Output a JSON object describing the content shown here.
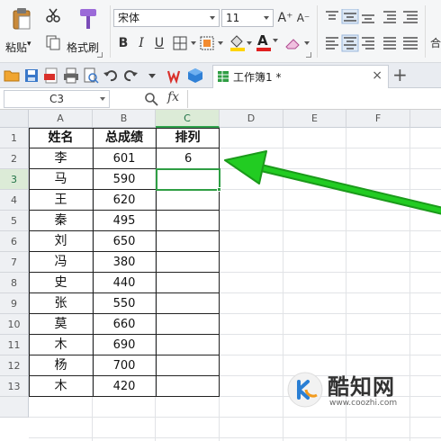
{
  "ribbon": {
    "paste_label": "粘贴",
    "format_painter_label": "格式刷",
    "font_name": "宋体",
    "font_size": "11",
    "grow_font": "A⁺",
    "shrink_font": "A⁻",
    "bold": "B",
    "italic": "I",
    "underline": "U",
    "font_color_letter": "A",
    "partial_right": "合"
  },
  "doc_tab": {
    "title": "工作簿1 *"
  },
  "formula_bar": {
    "name_box": "C3",
    "fx": "fx",
    "formula": ""
  },
  "columns": [
    "A",
    "B",
    "C",
    "D",
    "E",
    "F"
  ],
  "rows": [
    "1",
    "2",
    "3",
    "4",
    "5",
    "6",
    "7",
    "8",
    "9",
    "10",
    "11",
    "12",
    "13"
  ],
  "table": {
    "headers": [
      "姓名",
      "总成绩",
      "排列"
    ],
    "rows": [
      [
        "李",
        "601",
        "6"
      ],
      [
        "马",
        "590",
        ""
      ],
      [
        "王",
        "620",
        ""
      ],
      [
        "秦",
        "495",
        ""
      ],
      [
        "刘",
        "650",
        ""
      ],
      [
        "冯",
        "380",
        ""
      ],
      [
        "史",
        "440",
        ""
      ],
      [
        "张",
        "550",
        ""
      ],
      [
        "莫",
        "660",
        ""
      ],
      [
        "木",
        "690",
        ""
      ],
      [
        "杨",
        "700",
        ""
      ],
      [
        "木",
        "420",
        ""
      ]
    ]
  },
  "active_cell": "C3",
  "annotation": {
    "arrow_color": "#22cc22"
  },
  "watermark": {
    "brand": "酷知网",
    "url": "www.coozhi.com"
  },
  "colors": {
    "accent_green": "#2f9e44",
    "font_color_bar": "#e02020",
    "highlight_bar": "#ffd400"
  }
}
